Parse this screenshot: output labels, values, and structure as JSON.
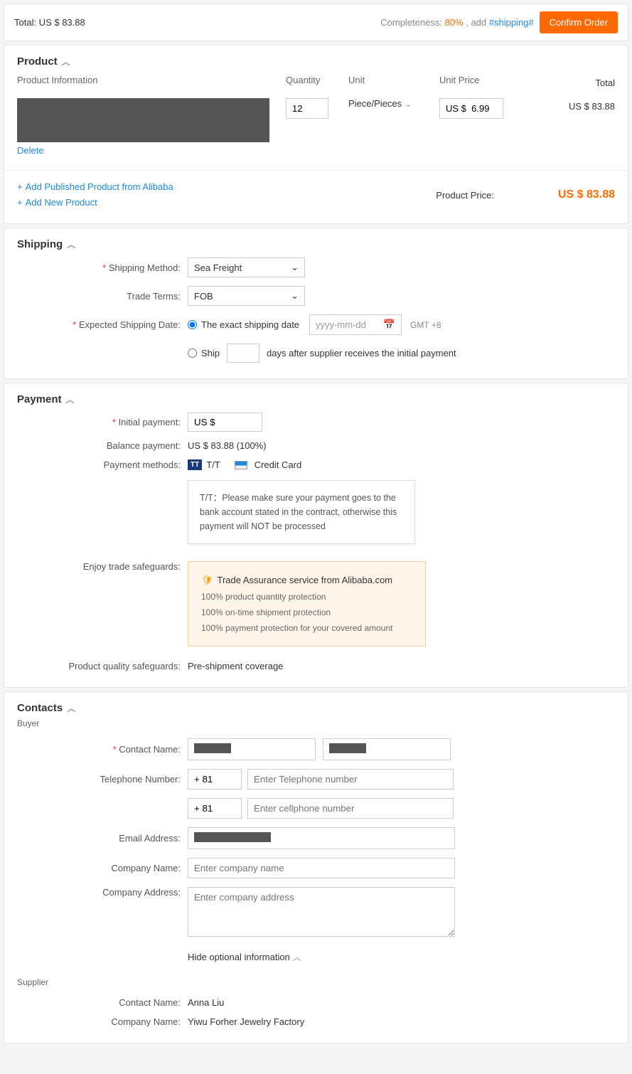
{
  "topbar": {
    "total_label": "Total: US $ 83.88",
    "completeness_label": "Completeness: ",
    "completeness_pct": "80%",
    "add_text": " , add ",
    "add_link": "#shipping#",
    "confirm": "Confirm Order"
  },
  "product": {
    "title": "Product",
    "info_label": "Product Information",
    "qty_label": "Quantity",
    "unit_label": "Unit",
    "unitprice_label": "Unit Price",
    "total_label": "Total",
    "qty": "12",
    "unit": "Piece/Pieces",
    "unitprice": "US $  6.99",
    "total": "US $ 83.88",
    "delete": "Delete",
    "add_published": "Add Published Product from Alibaba",
    "add_new": "Add New Product",
    "price_label": "Product Price:",
    "price_amount": "US $ 83.88"
  },
  "shipping": {
    "title": "Shipping",
    "method_label": "Shipping Method:",
    "method_value": "Sea Freight",
    "terms_label": "Trade Terms:",
    "terms_value": "FOB",
    "date_label": "Expected Shipping Date:",
    "exact_label": "The exact shipping date",
    "date_placeholder": "yyyy-mm-dd",
    "gmt": "GMT +8",
    "ship_label": "Ship",
    "after_label": "days after supplier receives the initial payment"
  },
  "payment": {
    "title": "Payment",
    "initial_label": "Initial payment:",
    "initial_value": "US $",
    "balance_label": "Balance payment:",
    "balance_value": "US $ 83.88 (100%)",
    "methods_label": "Payment methods:",
    "tt": "T/T",
    "cc": "Credit Card",
    "tooltip": "T/T：Please make sure your payment goes to the bank account stated in the contract, otherwise this payment will NOT be processed",
    "safeguards_label": "Enjoy trade safeguards:",
    "assurance_title": "Trade Assurance service from Alibaba.com",
    "assurance_1": "100% product quantity protection",
    "assurance_2": "100% on-time shipment protection",
    "assurance_3": "100% payment protection for your covered amount",
    "quality_label": "Product quality safeguards:",
    "quality_value": "Pre-shipment coverage"
  },
  "contacts": {
    "title": "Contacts",
    "buyer": "Buyer",
    "name_label": "Contact Name:",
    "phone_label": "Telephone Number:",
    "country_code": "+ 81",
    "phone_placeholder": "Enter Telephone number",
    "cell_placeholder": "Enter cellphone number",
    "email_label": "Email Address:",
    "company_label": "Company Name:",
    "company_placeholder": "Enter company name",
    "address_label": "Company Address:",
    "address_placeholder": "Enter company address",
    "hide_optional": "Hide optional information",
    "supplier": "Supplier",
    "sup_name": "Anna Liu",
    "sup_company": "Yiwu Forher Jewelry Factory"
  }
}
